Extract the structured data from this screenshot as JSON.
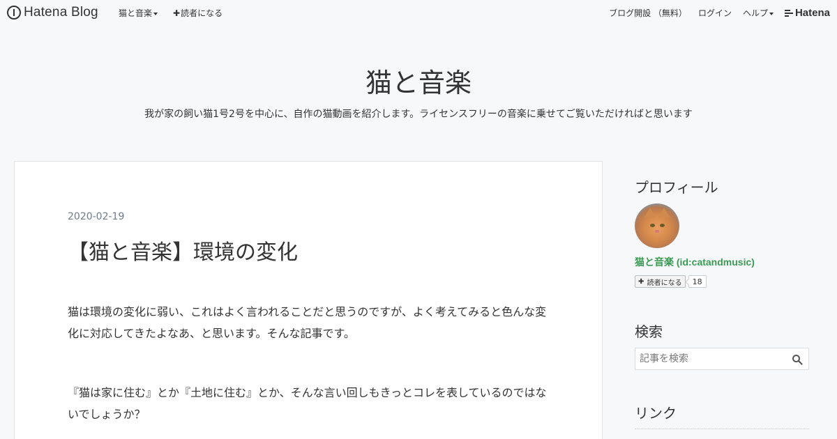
{
  "topbar": {
    "logo_text": "Hatena Blog",
    "nav_left": [
      {
        "label": "猫と音楽",
        "dropdown": true
      },
      {
        "label": "読者になる",
        "plus": true
      }
    ],
    "nav_right": {
      "open_blog": "ブログ開設 （無料）",
      "login": "ログイン",
      "help": "ヘルプ",
      "brand": "Hatena"
    }
  },
  "header": {
    "title": "猫と音楽",
    "description": "我が家の飼い猫1号2号を中心に、自作の猫動画を紹介します。ライセンスフリーの音楽に乗せてご覧いただければと思います"
  },
  "entry": {
    "date": "2020-02-19",
    "title": "【猫と音楽】環境の変化",
    "paragraphs": [
      "猫は環境の変化に弱い、これはよく言われることだと思うのですが、よく考えてみると色んな変化に対応してきたよなあ、と思います。そんな記事です。",
      "『猫は家に住む』とか『土地に住む』とか、そんな言い回しもきっとコレを表しているのではないでしょうか？"
    ]
  },
  "sidebar": {
    "profile_heading": "プロフィール",
    "profile_name": "猫と音楽 (id:catandmusic)",
    "reader_button": "読者になる",
    "reader_count": "18",
    "search_heading": "検索",
    "search_placeholder": "記事を検索",
    "links_heading": "リンク"
  },
  "colors": {
    "background": "#f7f8fa",
    "profile_name": "#3a9a52",
    "date": "#6d7b8a"
  },
  "icons": [
    "hatena-logo-icon",
    "caret-down-icon",
    "plus-icon",
    "hatena-brand-icon",
    "search-icon",
    "avatar-cat-image"
  ]
}
